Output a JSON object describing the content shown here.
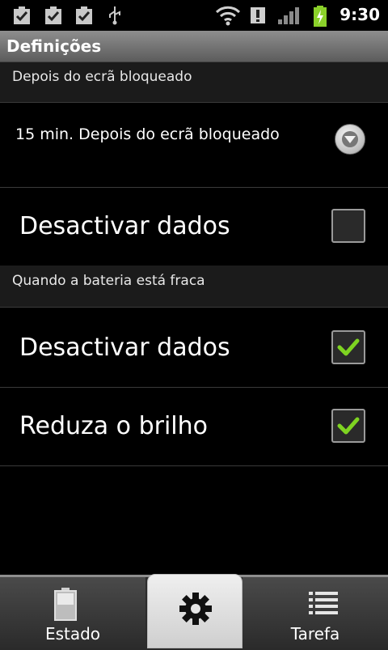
{
  "status_bar": {
    "time": "9:30",
    "icons": [
      "task-check-icon",
      "task-check-icon",
      "task-check-icon",
      "usb-icon",
      "wifi-icon",
      "alert-icon",
      "signal-icon",
      "battery-charging-icon"
    ]
  },
  "title_bar": {
    "title": "Definições"
  },
  "screen_lock_section": {
    "header": "Depois do ecrã bloqueado",
    "spinner": {
      "selected": "15 min. Depois do ecrã bloqueado"
    },
    "disable_data": {
      "label": "Desactivar dados",
      "checked": false
    }
  },
  "low_battery_section": {
    "header": "Quando a bateria está fraca",
    "disable_data": {
      "label": "Desactivar dados",
      "checked": true
    },
    "reduce_brightness": {
      "label": "Reduza o brilho",
      "checked": true
    }
  },
  "tabs": [
    {
      "label": "Estado",
      "icon": "battery-icon"
    },
    {
      "label": "",
      "icon": "gear-icon",
      "active": true
    },
    {
      "label": "Tarefa",
      "icon": "list-icon"
    }
  ],
  "colors": {
    "check": "#7ed321",
    "background": "#000000",
    "section_header": "#1b1b1b"
  }
}
